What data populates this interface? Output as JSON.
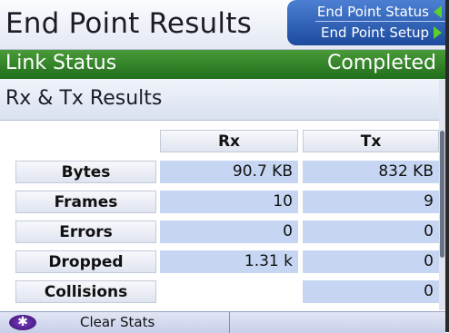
{
  "header": {
    "title": "End Point Results",
    "nav_tabs": [
      {
        "label": "End Point Status",
        "arrow": "left"
      },
      {
        "label": "End Point Setup",
        "arrow": "right"
      }
    ]
  },
  "link_status": {
    "label": "Link Status",
    "value": "Completed"
  },
  "section": {
    "title": "Rx & Tx Results"
  },
  "table": {
    "columns": [
      "Rx",
      "Tx"
    ],
    "rows": [
      {
        "label": "Bytes",
        "rx": "90.7 KB",
        "tx": "832 KB"
      },
      {
        "label": "Frames",
        "rx": "10",
        "tx": "9"
      },
      {
        "label": "Errors",
        "rx": "0",
        "tx": "0"
      },
      {
        "label": "Dropped",
        "rx": "1.31 k",
        "tx": "0"
      },
      {
        "label": "Collisions",
        "rx": "",
        "tx": "0"
      }
    ]
  },
  "softkeys": [
    {
      "icon": "asterisk-icon",
      "label": "Clear Stats"
    }
  ],
  "colors": {
    "link_bar": "#2f8229",
    "nav_tabs": "#2b5cb4",
    "value_cell": "#c6d5f1",
    "softkey_icon": "#5a2596"
  }
}
